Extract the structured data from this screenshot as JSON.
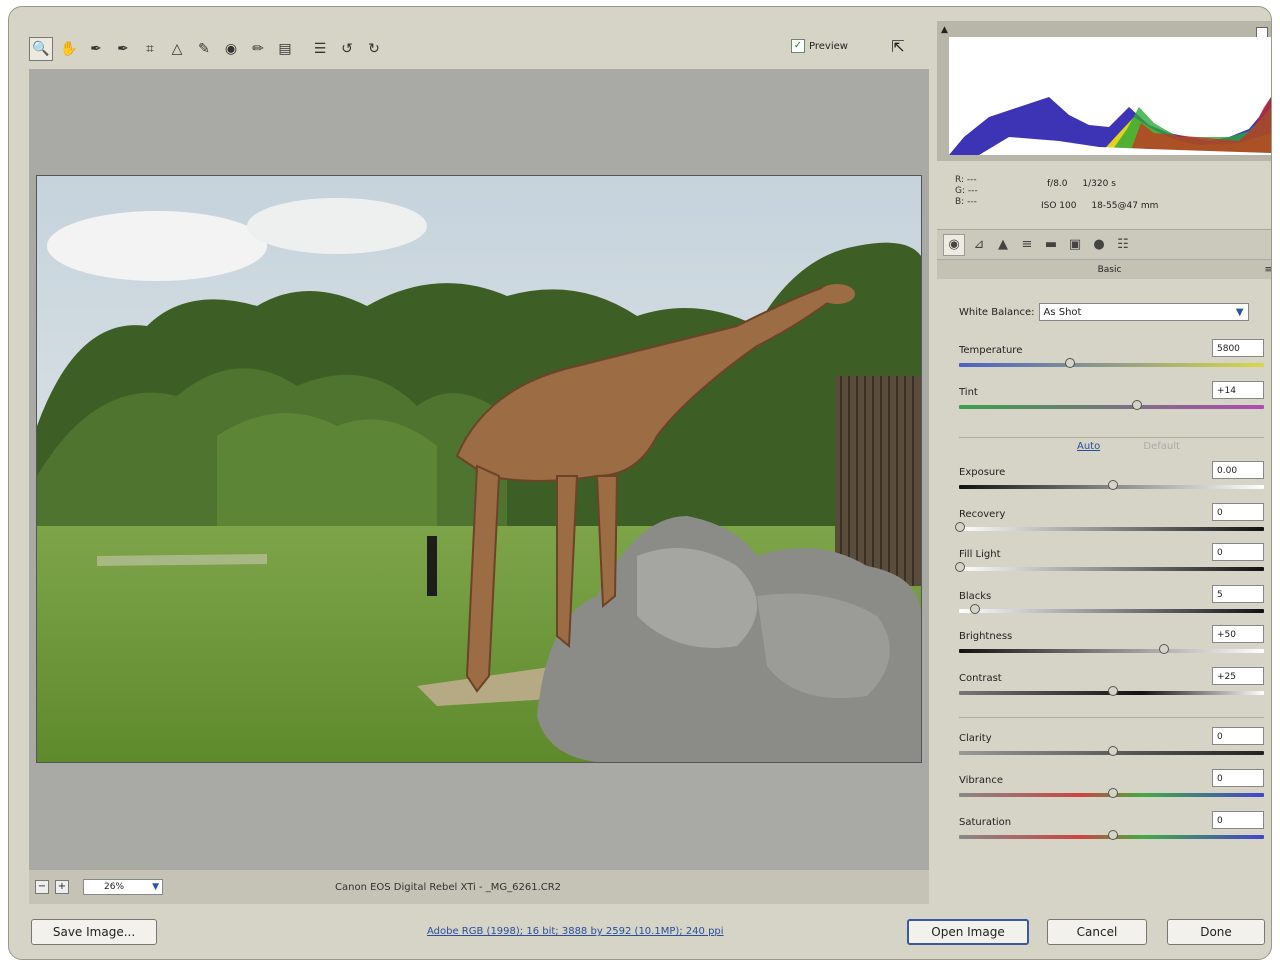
{
  "toolbar": {
    "tools": [
      {
        "name": "zoom-tool",
        "glyph": "🔍"
      },
      {
        "name": "hand-tool",
        "glyph": "✋"
      },
      {
        "name": "white-balance-tool",
        "glyph": "✒"
      },
      {
        "name": "color-sampler-tool",
        "glyph": "✒"
      },
      {
        "name": "crop-tool",
        "glyph": "⌗"
      },
      {
        "name": "straighten-tool",
        "glyph": "△"
      },
      {
        "name": "retouch-tool",
        "glyph": "✎"
      },
      {
        "name": "red-eye-tool",
        "glyph": "◉"
      },
      {
        "name": "brush-tool",
        "glyph": "✏"
      },
      {
        "name": "gradient-tool",
        "glyph": "▤"
      },
      {
        "name": "preferences-tool",
        "glyph": "☰"
      },
      {
        "name": "rotate-left-tool",
        "glyph": "↺"
      },
      {
        "name": "rotate-right-tool",
        "glyph": "↻"
      }
    ],
    "preview_label": "Preview",
    "preview_checked": true
  },
  "status": {
    "zoom": "26%",
    "filename": "Canon EOS Digital Rebel XTi - _MG_6261.CR2"
  },
  "info": {
    "r": "R:  ---",
    "g": "G:  ---",
    "b": "B:  ---",
    "aperture": "f/8.0",
    "shutter": "1/320 s",
    "iso": "ISO 100",
    "lens": "18-55@47 mm"
  },
  "panel": {
    "section_title": "Basic",
    "white_balance_label": "White Balance:",
    "white_balance_value": "As Shot",
    "auto_label": "Auto",
    "default_label": "Default",
    "controls": [
      {
        "id": "temperature",
        "label": "Temperature",
        "value": "5800",
        "position": 0.36
      },
      {
        "id": "tint",
        "label": "Tint",
        "value": "+14",
        "position": 0.58
      },
      {
        "id": "exposure",
        "label": "Exposure",
        "value": "0.00",
        "position": 0.5
      },
      {
        "id": "recovery",
        "label": "Recovery",
        "value": "0",
        "position": 0.0
      },
      {
        "id": "fill-light",
        "label": "Fill Light",
        "value": "0",
        "position": 0.0
      },
      {
        "id": "blacks",
        "label": "Blacks",
        "value": "5",
        "position": 0.05
      },
      {
        "id": "brightness",
        "label": "Brightness",
        "value": "+50",
        "position": 0.67
      },
      {
        "id": "contrast",
        "label": "Contrast",
        "value": "+25",
        "position": 0.5
      },
      {
        "id": "clarity",
        "label": "Clarity",
        "value": "0",
        "position": 0.5
      },
      {
        "id": "vibrance",
        "label": "Vibrance",
        "value": "0",
        "position": 0.5
      },
      {
        "id": "saturation",
        "label": "Saturation",
        "value": "0",
        "position": 0.5
      }
    ]
  },
  "footer": {
    "save_label": "Save Image...",
    "workflow_text": "Adobe RGB (1998); 16 bit; 3888 by 2592 (10.1MP); 240 ppi",
    "open_label": "Open Image",
    "cancel_label": "Cancel",
    "done_label": "Done"
  }
}
